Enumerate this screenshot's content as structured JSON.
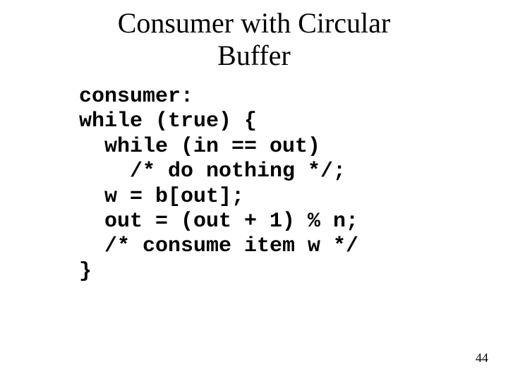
{
  "slide": {
    "title_line1": "Consumer with Circular",
    "title_line2": "Buffer",
    "page_number": "44"
  },
  "code": {
    "l0": "consumer:",
    "l1": "while (true) {",
    "l2": "  while (in == out)",
    "l3": "    /* do nothing */;",
    "l4": "  w = b[out];",
    "l5": "  out = (out + 1) % n;",
    "l6": "  /* consume item w */",
    "l7": "}"
  }
}
